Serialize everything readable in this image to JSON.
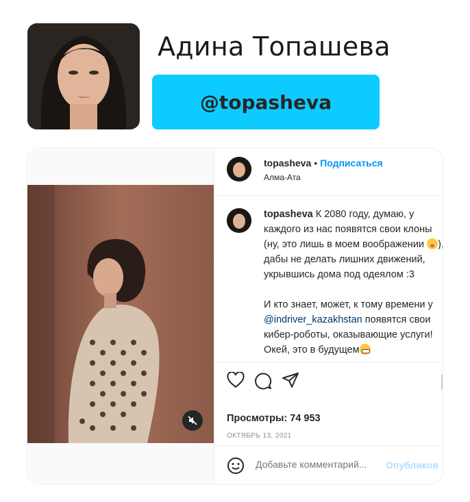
{
  "header": {
    "name": "Адина Топашева",
    "handle": "@topasheva"
  },
  "post": {
    "username": "topasheva",
    "separator": "•",
    "follow_label": "Подписаться",
    "location": "Алма-Ата",
    "caption": {
      "username": "topasheva",
      "line1": "К 2080 году, думаю, у каждого из нас появятся свои клоны (ну, это лишь в моем воображении",
      "line2": "), дабы не делать лишних движений, укрывшись дома под одеялом :3",
      "line3a": "И кто знает, может, к тому времени у",
      "mention": "@indriver_kazakhstan",
      "line3b": "появятся свои кибер-роботы, оказывающие услуги! Окей, это в будущем"
    },
    "views": "Просмотры: 74 953",
    "date": "ОКТЯБРЬ 13, 2021",
    "comment_placeholder": "Добавьте комментарий...",
    "publish_label": "Опубликов"
  },
  "colors": {
    "handle_bg": "#0ecbff",
    "follow": "#0095f6",
    "publish": "#b2dffc",
    "mention": "#00376b"
  },
  "icons": [
    "heart-icon",
    "comment-icon",
    "share-icon",
    "bookmark-icon",
    "mute-icon",
    "smile-icon"
  ]
}
